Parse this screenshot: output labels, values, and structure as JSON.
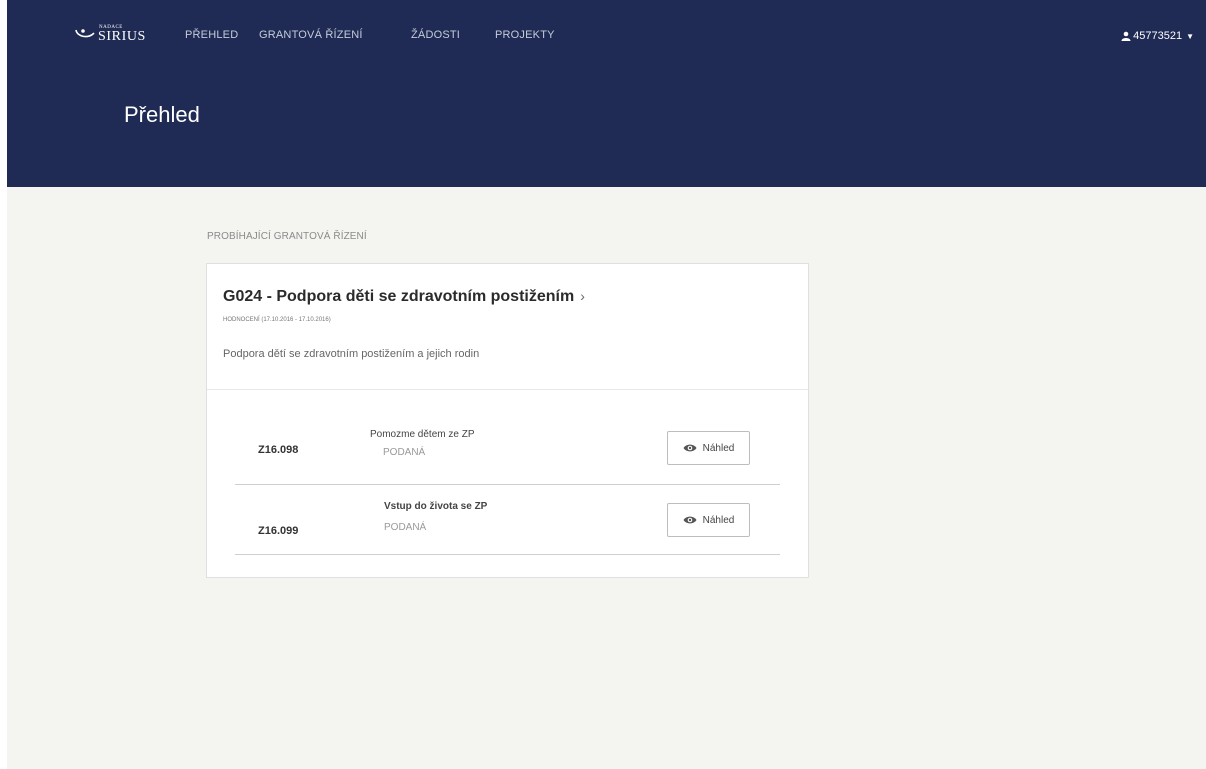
{
  "brand": {
    "small": "NADACE",
    "name": "SIRIUS"
  },
  "nav": {
    "items": [
      {
        "label": "PŘEHLED"
      },
      {
        "label": "GRANTOVÁ ŘÍZENÍ"
      },
      {
        "label": "ŽÁDOSTI"
      },
      {
        "label": "PROJEKTY"
      }
    ],
    "user": "45773521"
  },
  "page": {
    "title": "Přehled"
  },
  "section": {
    "label": "PROBÍHAJÍCÍ GRANTOVÁ ŘÍZENÍ"
  },
  "grant": {
    "title": "G024 - Podpora děti se zdravotním postižením",
    "chevron": "›",
    "phase": "HODNOCENÍ (17.10.2016 - 17.10.2016)",
    "description": "Podpora dětí se zdravotním postižením a jejich rodin"
  },
  "applications": [
    {
      "code": "Z16.098",
      "name": "Pomozme dětem ze ZP",
      "status": "PODANÁ",
      "action": "Náhled"
    },
    {
      "code": "Z16.099",
      "name": "Vstup do života se ZP",
      "status": "PODANÁ",
      "action": "Náhled"
    }
  ],
  "colors": {
    "header": "#1f2b55",
    "background": "#f4f4f1"
  },
  "icons": {
    "user": "user-icon",
    "preview": "eye-icon",
    "caret": "caret-down-icon"
  }
}
